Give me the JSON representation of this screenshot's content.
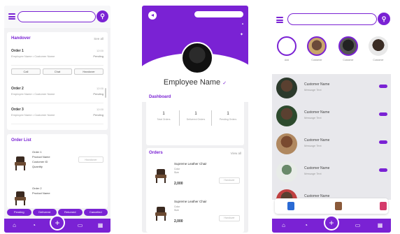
{
  "colors": {
    "accent": "#7a22d4",
    "badge": "#e0245e"
  },
  "screen1": {
    "search": {
      "placeholder": ""
    },
    "handover": {
      "title": "Handover",
      "see_all": "See all"
    },
    "orders": [
      {
        "name": "Order 1",
        "sub": "Employee Name  •  Customer Name",
        "status": "Pending",
        "time": "12:00"
      },
      {
        "name": "Order 2",
        "sub": "Employee Name  •  Customer Name",
        "status": "Pending",
        "time": "12:00"
      },
      {
        "name": "Order 3",
        "sub": "Employee Name  •  Customer Name",
        "status": "Pending",
        "time": "12:00"
      }
    ],
    "actions": [
      "Call",
      "Chat",
      "Handover"
    ],
    "order_list": {
      "title": "Order List",
      "items": [
        {
          "lines": [
            "Order 1",
            "Product Name",
            "Customer ID",
            "Quantity"
          ],
          "box": "Handover"
        },
        {
          "lines": [
            "Order 2",
            "Product Name"
          ],
          "box": ""
        }
      ]
    },
    "chips": [
      "Pending",
      "Delivered",
      "Returned",
      "Cancelled"
    ],
    "nav": [
      "home-icon",
      "chart-icon",
      "add-icon",
      "chat-icon",
      "calendar-icon"
    ]
  },
  "screen2": {
    "employee_name": "Employee Name",
    "dashboard": {
      "title": "Dashboard",
      "stats": [
        {
          "num": "1",
          "label": "Total Orders"
        },
        {
          "num": "1",
          "label": "Delivered Orders"
        },
        {
          "num": "1",
          "label": "Pending Orders"
        }
      ]
    },
    "orders": {
      "title": "Orders",
      "see_all": "View all",
      "items": [
        {
          "name": "Supreme Leather Chair",
          "detail": "Color\nSize",
          "price": "2,000",
          "box": "Handover"
        },
        {
          "name": "Supreme Leather Chair",
          "detail": "Color\nSize",
          "price": "2,000",
          "box": "Handover"
        }
      ]
    }
  },
  "screen3": {
    "stories": [
      {
        "label": "Add"
      },
      {
        "label": "Customer"
      },
      {
        "label": "Customer"
      },
      {
        "label": "Customer"
      }
    ],
    "chats": [
      {
        "name": "Customer Name",
        "message": "Message Text"
      },
      {
        "name": "Customer Name",
        "message": "Message Text"
      },
      {
        "name": "Customer Name",
        "message": "Message Text"
      },
      {
        "name": "Customer Name",
        "message": "Message Text"
      },
      {
        "name": "Customer Name",
        "message": ""
      }
    ]
  }
}
